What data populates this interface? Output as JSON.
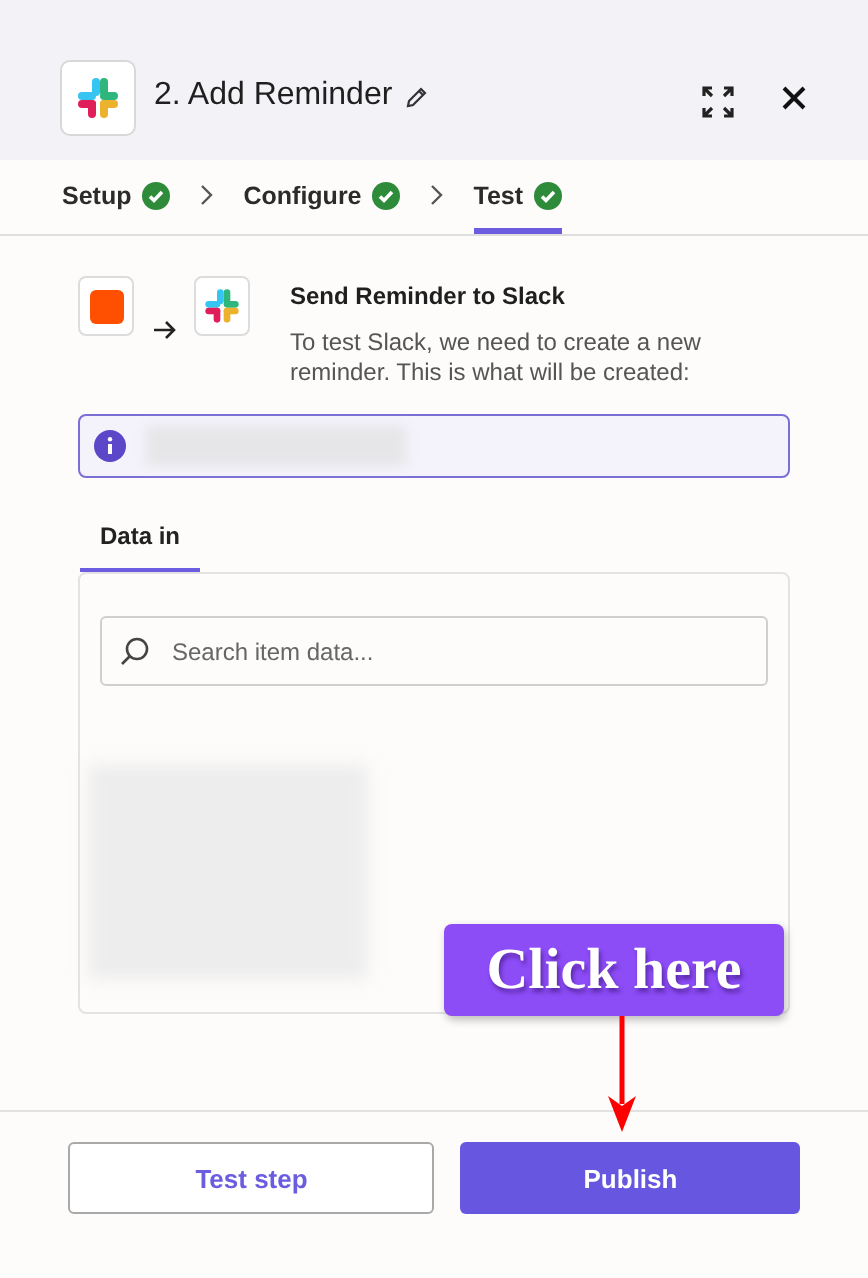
{
  "header": {
    "title": "2. Add Reminder"
  },
  "steps": [
    {
      "label": "Setup",
      "complete": true,
      "selected": false
    },
    {
      "label": "Configure",
      "complete": true,
      "selected": false
    },
    {
      "label": "Test",
      "complete": true,
      "selected": true
    }
  ],
  "action": {
    "title": "Send Reminder to Slack",
    "description": "To test Slack, we need to create a new reminder. This is what will be created:"
  },
  "data_tabs": [
    {
      "label": "Data in",
      "selected": true
    }
  ],
  "search": {
    "placeholder": "Search item data..."
  },
  "annotation": {
    "text": "Click here"
  },
  "buttons": [
    {
      "label": "Test step",
      "kind": "secondary"
    },
    {
      "label": "Publish",
      "kind": "primary"
    }
  ]
}
